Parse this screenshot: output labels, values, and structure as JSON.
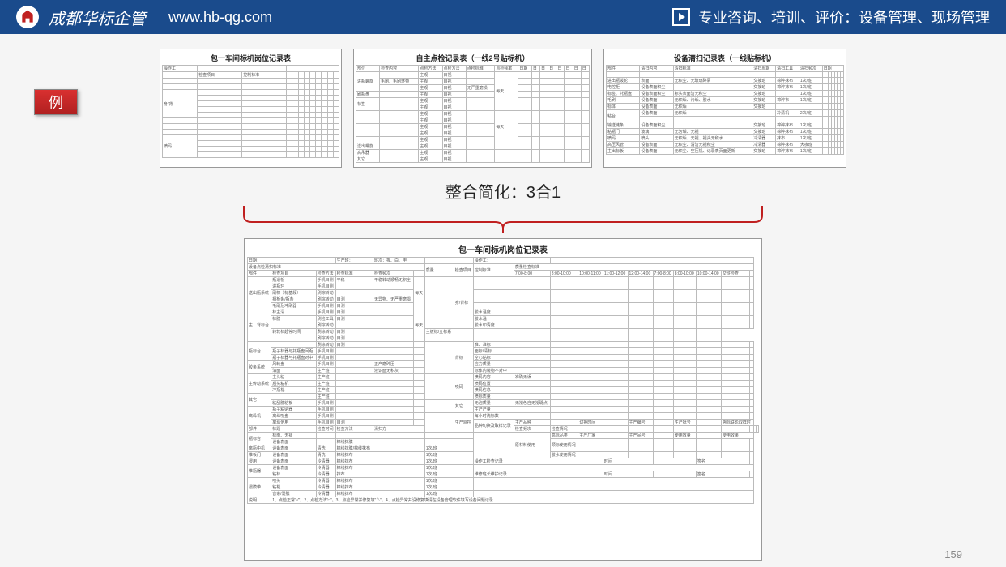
{
  "header": {
    "company": "成都华标企管",
    "url": "www.hb-qg.com",
    "right": "专业咨询、培训、评价：设备管理、现场管理"
  },
  "badge": "例",
  "forms": {
    "f1_title": "包一车间标机岗位记录表",
    "f2_title": "自主点检记录表（一线2号贴标机）",
    "f3_title": "设备清扫记录表（一线贴标机）"
  },
  "center_label": "整合简化：3合1",
  "big_form": {
    "title": "包一车间标机岗位记录表",
    "row1": {
      "date": "日期：",
      "line": "生产班：",
      "shift": "班次：夜、白、甲",
      "worker": "操作工："
    },
    "section_left": "设备点检清扫标准",
    "section_right": "质量检查标准",
    "cols_left": [
      "部件",
      "检查项目",
      "检查方法",
      "检查标准",
      "检查频次",
      "质量",
      "检查项目",
      "控制标准"
    ],
    "time_cols": [
      "7:00-8:00",
      "8:00-10:00",
      "10:00-11:00",
      "11:00-12:00",
      "12:00-14:00",
      "7:00-8:00",
      "8:00-10:00",
      "10:00-14:00",
      "交班检查"
    ],
    "sections": [
      "送出瓶系统",
      "主、背标台",
      "瓶标台",
      "胶条系统",
      "主传动系统",
      "其它",
      "离垛机",
      "部件",
      "瓶标台",
      "离垛机",
      "推瓶器",
      "浸膜带",
      "说明"
    ],
    "r_sections": [
      "身/背标",
      "背标",
      "喷码",
      "其它",
      "生产监控",
      "原材料使用",
      "操作工检查记录",
      "维修班长维护记录"
    ]
  },
  "page": "159"
}
